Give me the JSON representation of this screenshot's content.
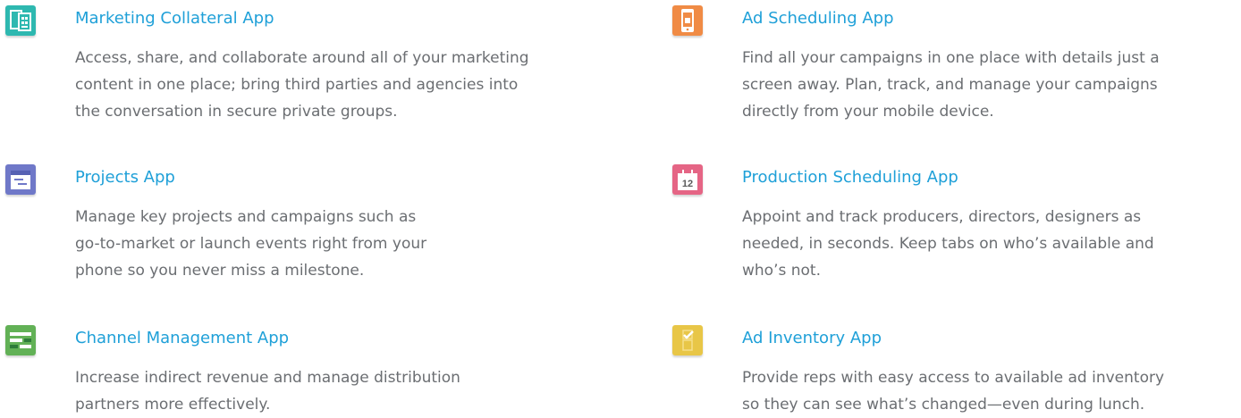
{
  "colors": {
    "title": "#1fa0d8",
    "text": "#6b6e72",
    "marketing_icon": "#2eb8b0",
    "projects_icon": "#6f78c8",
    "channel_icon": "#62b156",
    "ad_scheduling_icon": "#f08b45",
    "production_icon": "#e56585",
    "inventory_icon": "#e8c647"
  },
  "apps": [
    {
      "icon": "documents-icon",
      "title": "Marketing Collateral App",
      "lines": [
        "Access, share, and collaborate around all of your marketing",
        "content in one place; bring third parties and agencies into",
        "the conversation in secure private groups."
      ]
    },
    {
      "icon": "window-icon",
      "title": "Projects App",
      "lines": [
        "Manage key projects and campaigns such as",
        "go-to-market or launch events right from your",
        "phone so you never miss a milestone."
      ]
    },
    {
      "icon": "bars-icon",
      "title": "Channel Management App",
      "lines": [
        "Increase indirect revenue and manage distribution",
        "partners more effectively."
      ]
    },
    {
      "icon": "mobile-phone-icon",
      "title": "Ad Scheduling App",
      "lines": [
        "Find all your campaigns in one place with details just a",
        "screen away. Plan, track, and manage your campaigns",
        "directly from your mobile device."
      ]
    },
    {
      "icon": "calendar-icon",
      "calendar_day": "12",
      "title": "Production Scheduling App",
      "lines": [
        "Appoint and track producers, directors, designers as",
        "needed, in seconds. Keep tabs on who’s available and",
        "who’s not."
      ]
    },
    {
      "icon": "checklist-icon",
      "title": "Ad Inventory App",
      "lines": [
        "Provide reps with easy access to available ad inventory",
        "so they can see what’s changed—even during lunch."
      ]
    }
  ]
}
